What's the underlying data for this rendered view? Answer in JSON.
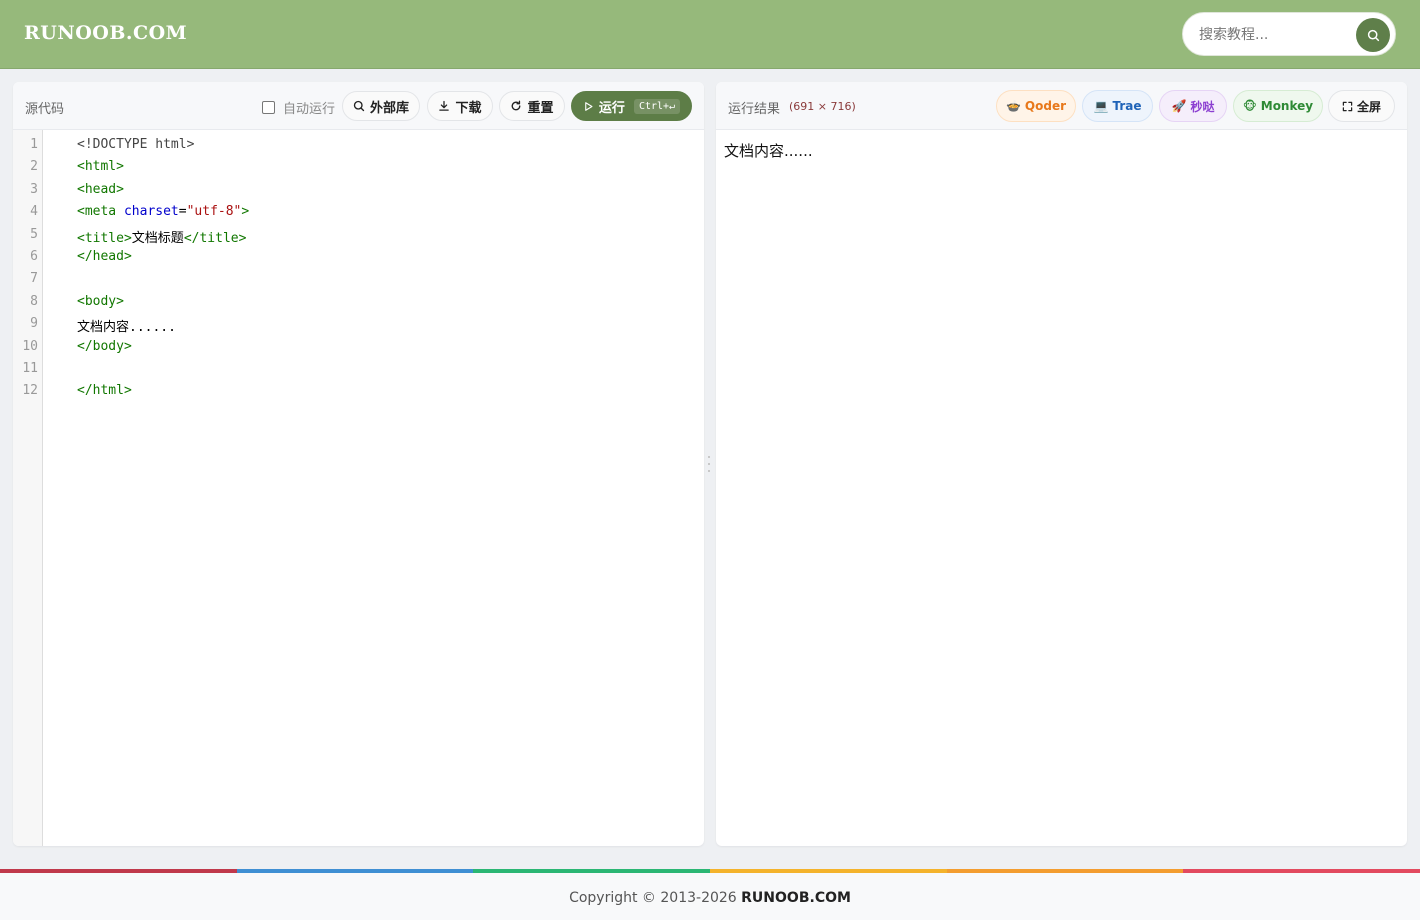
{
  "header": {
    "logo": "RUNOOB.COM",
    "search_placeholder": "搜索教程..."
  },
  "editor": {
    "title": "源代码",
    "auto_run_label": "自动运行",
    "buttons": {
      "external_libs": "外部库",
      "download": "下载",
      "reset": "重置",
      "run": "运行",
      "run_shortcut": "Ctrl+↵"
    },
    "code_lines": [
      "<!DOCTYPE html>",
      "<html>",
      "<head>",
      "<meta charset=\"utf-8\">",
      "<title>文档标题</title>",
      "</head>",
      "",
      "<body>",
      "文档内容......",
      "</body>",
      "",
      "</html>"
    ],
    "line_numbers": [
      "1",
      "2",
      "3",
      "4",
      "5",
      "6",
      "7",
      "8",
      "9",
      "10",
      "11",
      "12"
    ]
  },
  "result": {
    "title": "运行结果",
    "size": "(691 × 716)",
    "output_text": "文档内容......",
    "buttons": {
      "qoder": "Qoder",
      "trae": "Trae",
      "miaoda": "秒哒",
      "monkey": "Monkey",
      "fullscreen": "全屏"
    }
  },
  "footer": {
    "copyright_prefix": "Copyright © 2013-2026",
    "copyright_brand": "RUNOOB.COM"
  },
  "colors": {
    "header_bg": "#96b97b",
    "run_button": "#5d7d47",
    "footer_stripes": [
      "#c0394b",
      "#3f8fd3",
      "#2bb673",
      "#f4b32b",
      "#f39d2f",
      "#e24a5f"
    ]
  }
}
